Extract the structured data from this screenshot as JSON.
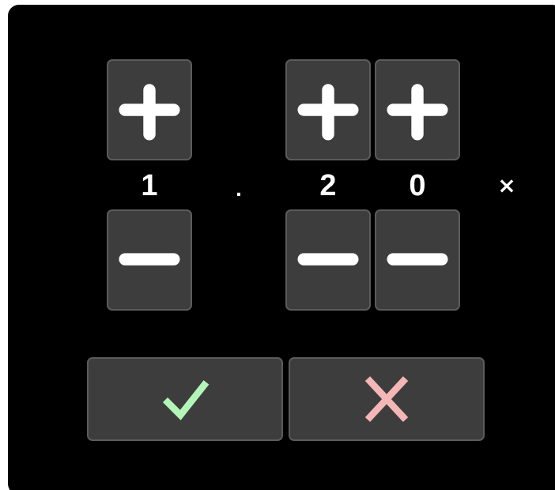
{
  "window": {
    "background_color": "#000000"
  },
  "value": {
    "digits": [
      "1",
      "2",
      "0"
    ],
    "decimal_separator": ".",
    "suffix": "×"
  },
  "steppers": {
    "increment_icon": "plus-icon",
    "decrement_icon": "minus-icon"
  },
  "actions": {
    "confirm_icon": "checkmark-icon",
    "confirm_color": "#b3f5b9",
    "cancel_icon": "x-icon",
    "cancel_color": "#f5b6b6"
  },
  "colors": {
    "button_fill": "#3d3d3d",
    "button_border": "#5b5b5b",
    "text": "#ffffff"
  }
}
